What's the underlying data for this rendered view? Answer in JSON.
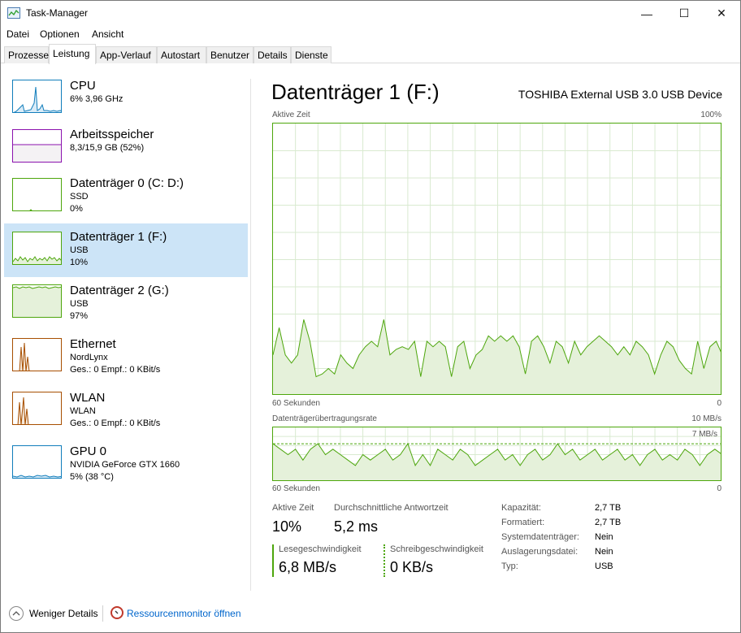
{
  "window": {
    "title": "Task-Manager",
    "minimize": "—",
    "maximize": "☐",
    "close": "✕"
  },
  "menu": [
    "Datei",
    "Optionen",
    "Ansicht"
  ],
  "tabs": [
    "Prozesse",
    "Leistung",
    "App-Verlauf",
    "Autostart",
    "Benutzer",
    "Details",
    "Dienste"
  ],
  "active_tab": "Leistung",
  "sidebar": [
    {
      "name": "CPU",
      "line1": "6% 3,96 GHz",
      "line2": "",
      "color": "#117dbb"
    },
    {
      "name": "Arbeitsspeicher",
      "line1": "8,3/15,9 GB (52%)",
      "line2": "",
      "color": "#8b12ae"
    },
    {
      "name": "Datenträger 0 (C: D:)",
      "line1": "SSD",
      "line2": "0%",
      "color": "#4da60c"
    },
    {
      "name": "Datenträger 1 (F:)",
      "line1": "USB",
      "line2": "10%",
      "color": "#4da60c"
    },
    {
      "name": "Datenträger 2 (G:)",
      "line1": "USB",
      "line2": "97%",
      "color": "#4da60c"
    },
    {
      "name": "Ethernet",
      "line1": "NordLynx",
      "line2": "Ges.: 0 Empf.: 0 KBit/s",
      "color": "#a74f01"
    },
    {
      "name": "WLAN",
      "line1": "WLAN",
      "line2": "Ges.: 0 Empf.: 0 KBit/s",
      "color": "#a74f01"
    },
    {
      "name": "GPU 0",
      "line1": "NVIDIA GeForce GTX 1660",
      "line2": "5% (38 °C)",
      "color": "#117dbb"
    }
  ],
  "main": {
    "title": "Datenträger 1 (F:)",
    "device": "TOSHIBA External USB 3.0 USB Device",
    "graph1": {
      "label": "Aktive Zeit",
      "max": "100%",
      "xlabel": "60 Sekunden",
      "xmin": "0"
    },
    "graph2": {
      "label": "Datenträgerübertragungsrate",
      "max": "10 MB/s",
      "ref": "7 MB/s",
      "xlabel": "60 Sekunden",
      "xmin": "0"
    },
    "stats": {
      "active_label": "Aktive Zeit",
      "active_value": "10%",
      "resp_label": "Durchschnittliche Antwortzeit",
      "resp_value": "5,2 ms",
      "read_label": "Lesegeschwindigkeit",
      "read_value": "6,8 MB/s",
      "write_label": "Schreibgeschwindigkeit",
      "write_value": "0 KB/s"
    },
    "props": [
      {
        "key": "Kapazität:",
        "value": "2,7 TB"
      },
      {
        "key": "Formatiert:",
        "value": "2,7 TB"
      },
      {
        "key": "Systemdatenträger:",
        "value": "Nein"
      },
      {
        "key": "Auslagerungsdatei:",
        "value": "Nein"
      },
      {
        "key": "Typ:",
        "value": "USB"
      }
    ]
  },
  "footer": {
    "fewer_details": "Weniger Details",
    "resmon": "Ressourcenmonitor öffnen"
  },
  "colors": {
    "accent_green": "#4da60c",
    "selection": "#cce4f7",
    "link": "#0066cc"
  },
  "chart_data": [
    {
      "type": "area",
      "title": "Aktive Zeit",
      "ylim": [
        0,
        100
      ],
      "unit": "%",
      "values": [
        15,
        25,
        15,
        12,
        15,
        28,
        20,
        7,
        8,
        10,
        8,
        15,
        12,
        10,
        15,
        18,
        20,
        18,
        28,
        15,
        17,
        18,
        17,
        20,
        7,
        20,
        18,
        20,
        18,
        7,
        18,
        20,
        10,
        15,
        17,
        22,
        20,
        22,
        20,
        22,
        18,
        8,
        20,
        22,
        18,
        12,
        20,
        18,
        12,
        20,
        15,
        18,
        20,
        22,
        20,
        18,
        15,
        18,
        15,
        20,
        18,
        15,
        8,
        15,
        20,
        18,
        13,
        10,
        8,
        20,
        10,
        18,
        20,
        15
      ]
    },
    {
      "type": "area",
      "title": "Datenträgerübertragungsrate",
      "ylim": [
        0,
        10
      ],
      "unit": "MB/s",
      "reference": 7,
      "values": [
        7,
        6,
        5,
        6,
        4,
        6,
        7,
        5,
        6,
        5,
        4,
        3,
        5,
        4,
        5,
        6,
        4,
        5,
        7,
        3,
        5,
        3,
        6,
        5,
        4,
        6,
        5,
        3,
        4,
        5,
        6,
        4,
        5,
        3,
        5,
        6,
        4,
        5,
        7,
        5,
        6,
        4,
        5,
        6,
        4,
        5,
        6,
        4,
        5,
        3,
        5,
        6,
        4,
        5,
        4,
        6,
        5,
        3,
        5,
        6,
        5
      ]
    }
  ]
}
